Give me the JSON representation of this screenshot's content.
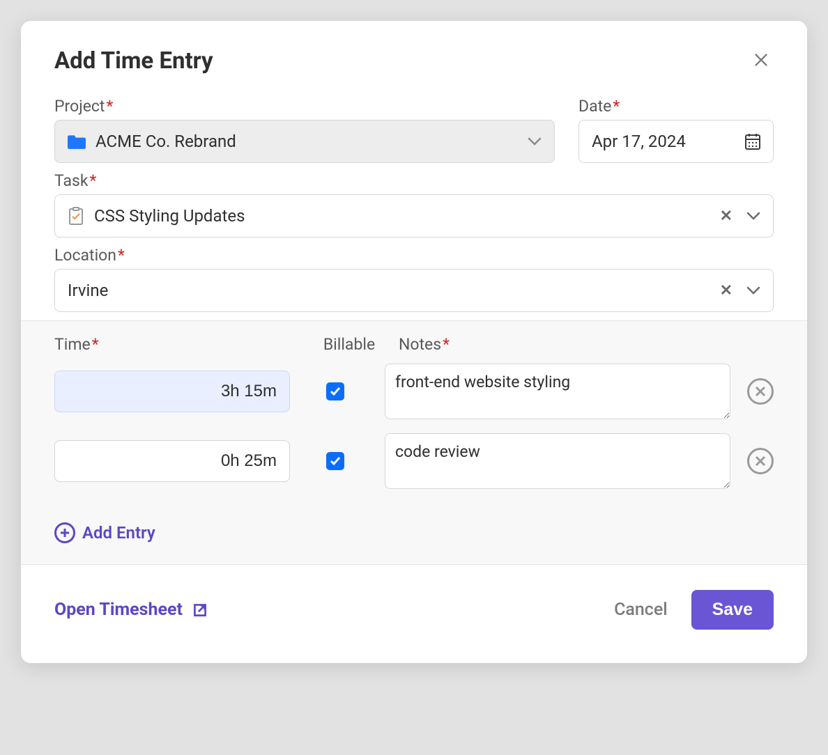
{
  "modal": {
    "title": "Add Time Entry"
  },
  "form": {
    "project": {
      "label": "Project",
      "value": "ACME Co. Rebrand"
    },
    "date": {
      "label": "Date",
      "value": "Apr 17, 2024"
    },
    "task": {
      "label": "Task",
      "value": "CSS Styling Updates"
    },
    "location": {
      "label": "Location",
      "value": "Irvine"
    }
  },
  "entries": {
    "headers": {
      "time": "Time",
      "billable": "Billable",
      "notes": "Notes"
    },
    "rows": [
      {
        "time": "3h 15m",
        "billable": true,
        "notes": "front-end website styling"
      },
      {
        "time": "0h 25m",
        "billable": true,
        "notes": "code review"
      }
    ],
    "add_label": "Add Entry"
  },
  "footer": {
    "open_timesheet": "Open Timesheet",
    "cancel": "Cancel",
    "save": "Save"
  }
}
